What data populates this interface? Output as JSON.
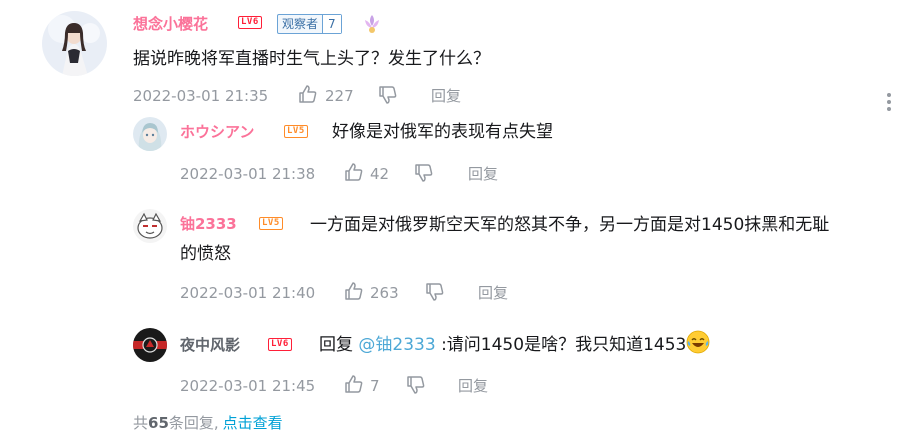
{
  "main_comment": {
    "username": "想念小樱花",
    "level": "LV6",
    "medal_name": "观察者",
    "medal_level": "7",
    "content": "据说昨晚将军直播时生气上头了？发生了什么？",
    "time": "2022-03-01 21:35",
    "likes": "227",
    "reply_label": "回复"
  },
  "replies": [
    {
      "username": "ホウシアン",
      "level": "LV5",
      "content": "好像是对俄军的表现有点失望",
      "time": "2022-03-01 21:38",
      "likes": "42",
      "reply_label": "回复"
    },
    {
      "username": "铀2333",
      "level": "LV5",
      "content_line1": "一方面是对俄罗斯空天军的怒其不争，另一方面是对1450抹黑和无耻",
      "content_line2": "的愤怒",
      "time": "2022-03-01 21:40",
      "likes": "263",
      "reply_label": "回复"
    },
    {
      "username": "夜中风影",
      "level": "LV6",
      "reply_prefix": "回复",
      "mention": "@铀2333",
      "content": ":请问1450是啥？我只知道1453",
      "emoji": "laughing-tears-emoji",
      "time": "2022-03-01 21:45",
      "likes": "7",
      "reply_label": "回复"
    }
  ],
  "summary": {
    "prefix": "共",
    "count": "65",
    "suffix": "条回复,",
    "view_link": "点击查看"
  },
  "icons": {
    "like": "thumb-up-icon",
    "dislike": "thumb-down-icon",
    "more": "more-vertical-icon"
  },
  "colors": {
    "username_pink": "#fb7299",
    "meta_gray": "#9499a0",
    "link_blue": "#00a1d6",
    "mention_blue": "#4da8d6",
    "lv6": "#ff1f38",
    "lv5": "#ff8c29"
  }
}
